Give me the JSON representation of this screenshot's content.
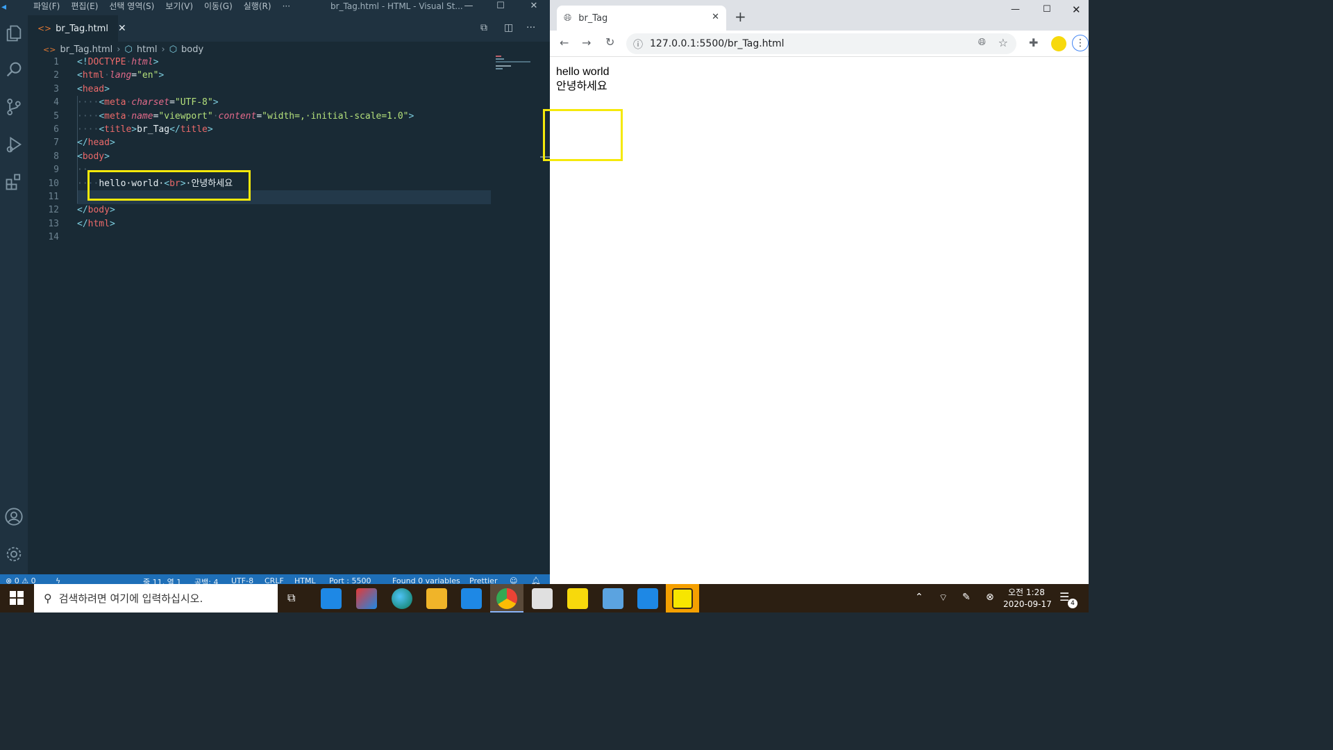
{
  "vscode": {
    "menu": [
      "파일(F)",
      "편집(E)",
      "선택 영역(S)",
      "보기(V)",
      "이동(G)",
      "실행(R)",
      "···"
    ],
    "window_title": "br_Tag.html - HTML - Visual St...",
    "tab": {
      "label": "br_Tag.html",
      "close": "✕"
    },
    "breadcrumb": [
      "br_Tag.html",
      "html",
      "body"
    ],
    "lines": [
      {
        "n": "1"
      },
      {
        "n": "2"
      },
      {
        "n": "3"
      },
      {
        "n": "4"
      },
      {
        "n": "5"
      },
      {
        "n": "6"
      },
      {
        "n": "7"
      },
      {
        "n": "8"
      },
      {
        "n": "9"
      },
      {
        "n": "10"
      },
      {
        "n": "11"
      },
      {
        "n": "12"
      },
      {
        "n": "13"
      },
      {
        "n": "14"
      }
    ],
    "code": {
      "l1_a": "<!",
      "l1_b": "DOCTYPE",
      "l1_c": "·",
      "l1_d": "html",
      "l1_e": ">",
      "l2_tag": "html",
      "l2_attr": "lang",
      "l2_val": "\"en\"",
      "l3_tag": "head",
      "l4_tag": "meta",
      "l4_attr": "charset",
      "l4_val": "\"UTF-8\"",
      "l5_tag": "meta",
      "l5_attr1": "name",
      "l5_val1": "\"viewport\"",
      "l5_attr2": "content",
      "l5_val2": "\"width=,·initial-scale=1.0\"",
      "l6_tag": "title",
      "l6_text": "br_Tag",
      "l6_close": "title",
      "l7_tag": "head",
      "l8_tag": "body",
      "l10_text1": "hello·world·",
      "l10_tag": "br",
      "l10_text2": "·안녕하세요",
      "l12_tag": "body",
      "l13_tag": "html"
    },
    "status": {
      "errors": "⊗ 0 ⚠ 0",
      "position": "줄 11, 열 1",
      "spaces": "공백: 4",
      "encoding": "UTF-8",
      "eol": "CRLF",
      "language": "HTML",
      "port": "Port : 5500",
      "vars": "Found 0 variables",
      "formatter": "Prettier"
    }
  },
  "browser": {
    "tab_title": "br_Tag",
    "url": "127.0.0.1:5500/br_Tag.html",
    "page_line1": "hello world",
    "page_line2": "안녕하세요"
  },
  "taskbar": {
    "search_placeholder": "검색하려면 여기에 입력하십시오.",
    "time": "오전 1:28",
    "date": "2020-09-17",
    "notification_count": "4"
  },
  "colors": {
    "highlight": "#f5e90b",
    "editor_bg": "#192a35",
    "status_bg": "#1e6fb8",
    "taskbar_bg": "#2c1f12"
  }
}
